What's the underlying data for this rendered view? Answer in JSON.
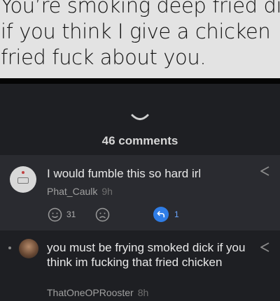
{
  "meme": {
    "lines": [
      "You’re smoking deep fried dick",
      "if you think I give a chicken",
      "fried fuck about you."
    ]
  },
  "comments_header": {
    "count_label": "46 comments"
  },
  "comments": [
    {
      "text": "I would fumble this so hard irl",
      "author": "Phat_Caulk",
      "age": "9h",
      "smile_count": "31",
      "reply_count": "1"
    },
    {
      "text": "you must be frying smoked dick if you think im fucking that fried chicken",
      "author": "ThatOneOPRooster",
      "age": "8h"
    }
  ],
  "icons": {
    "collapse": "chevron-down-icon",
    "share": "share-icon",
    "smile": "smile-icon",
    "frown": "frown-icon",
    "reply": "reply-icon"
  },
  "colors": {
    "caption_bg": "#e3e3e3",
    "panel_bg": "#1e1f23",
    "highlight_comment_bg": "#2a2b30",
    "reply_accent": "#2f7de6"
  }
}
